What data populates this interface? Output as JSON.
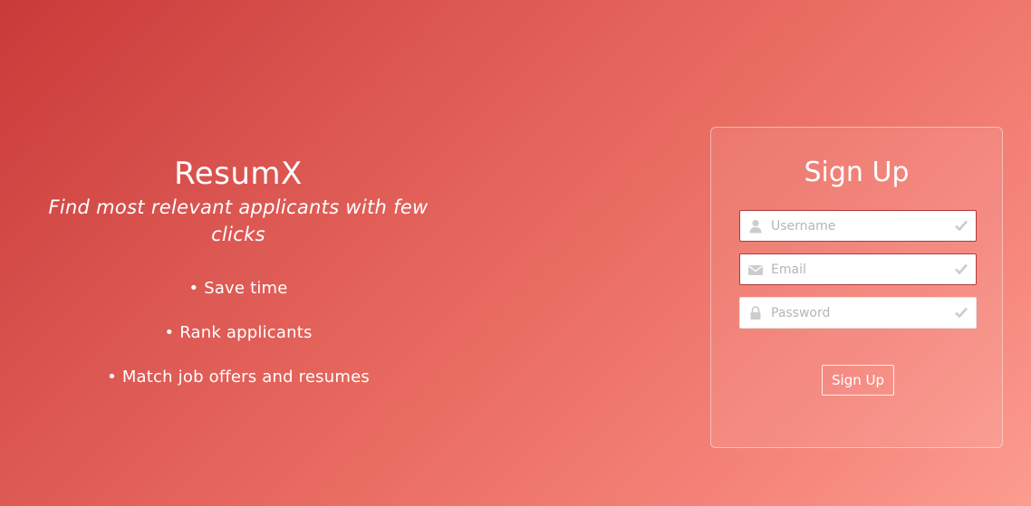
{
  "hero": {
    "title": "ResumX",
    "tagline": "Find most relevant applicants with few clicks",
    "features": [
      "Save time",
      "Rank applicants",
      "Match job offers and resumes"
    ]
  },
  "signup": {
    "title": "Sign Up",
    "fields": [
      {
        "icon": "user-icon",
        "placeholder": "Username",
        "value": ""
      },
      {
        "icon": "envelope-icon",
        "placeholder": "Email",
        "value": ""
      },
      {
        "icon": "lock-icon",
        "placeholder": "Password",
        "value": ""
      }
    ],
    "submit_label": "Sign Up"
  },
  "colors": {
    "gradient_start": "#c83a39",
    "gradient_end": "#fc9c90",
    "field_border": "#b23a3a",
    "icon_gray": "#cccccc"
  }
}
